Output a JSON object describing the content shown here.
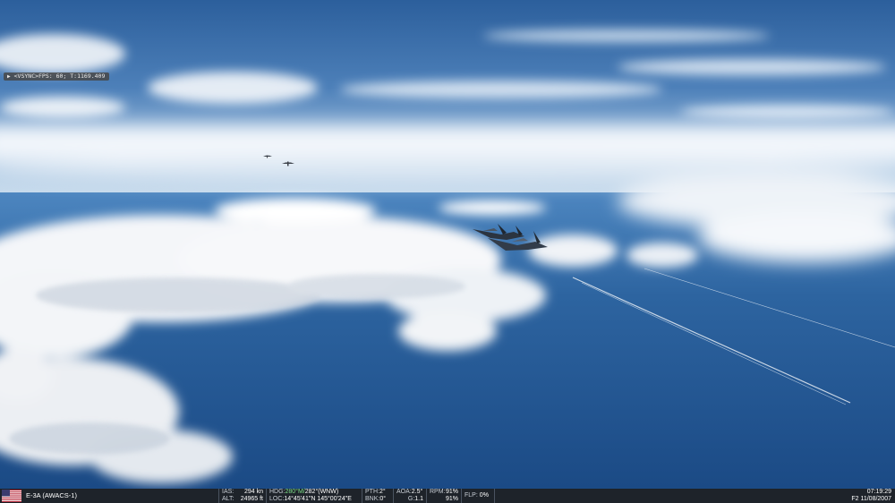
{
  "overlay": {
    "fps_text": "<VSYNC>FPS: 60; T:1169.409"
  },
  "status_bar": {
    "flag_icon": "us-flag-icon",
    "unit_name": "E-3A (AWACS-1)",
    "ias_label": "IAS:",
    "ias_value": "294 kn",
    "alt_label": "ALT:",
    "alt_value": "24965 ft",
    "hdg_label": "HDG:",
    "hdg_value": "280°M/",
    "hdg_true": "282°(WNW)",
    "loc_label": "LOC:",
    "loc_value": "14°45'41\"N 145°00'24\"E",
    "pth_label": "PTH:",
    "pth_value": "2°",
    "bnk_label": "BNK:",
    "bnk_value": "0°",
    "aoa_label": "AOA:",
    "aoa_value": "2.5°",
    "g_label": "G:",
    "g_value": "1.1",
    "rpm_label": "RPM:",
    "rpm1_value": "91%",
    "rpm2_value": "91%",
    "flp_label": "FLP:",
    "flp_value": "0%",
    "time": "07:19:29",
    "date": "F2 11/08/2007"
  },
  "colors": {
    "sky_top": "#2c5f9c",
    "sky_horizon": "#9fc0e0",
    "ocean": "#1e4f8a",
    "cloud": "#ffffff",
    "statusbar_bg": "#1e232a",
    "heading_accent": "#7fe08a"
  }
}
